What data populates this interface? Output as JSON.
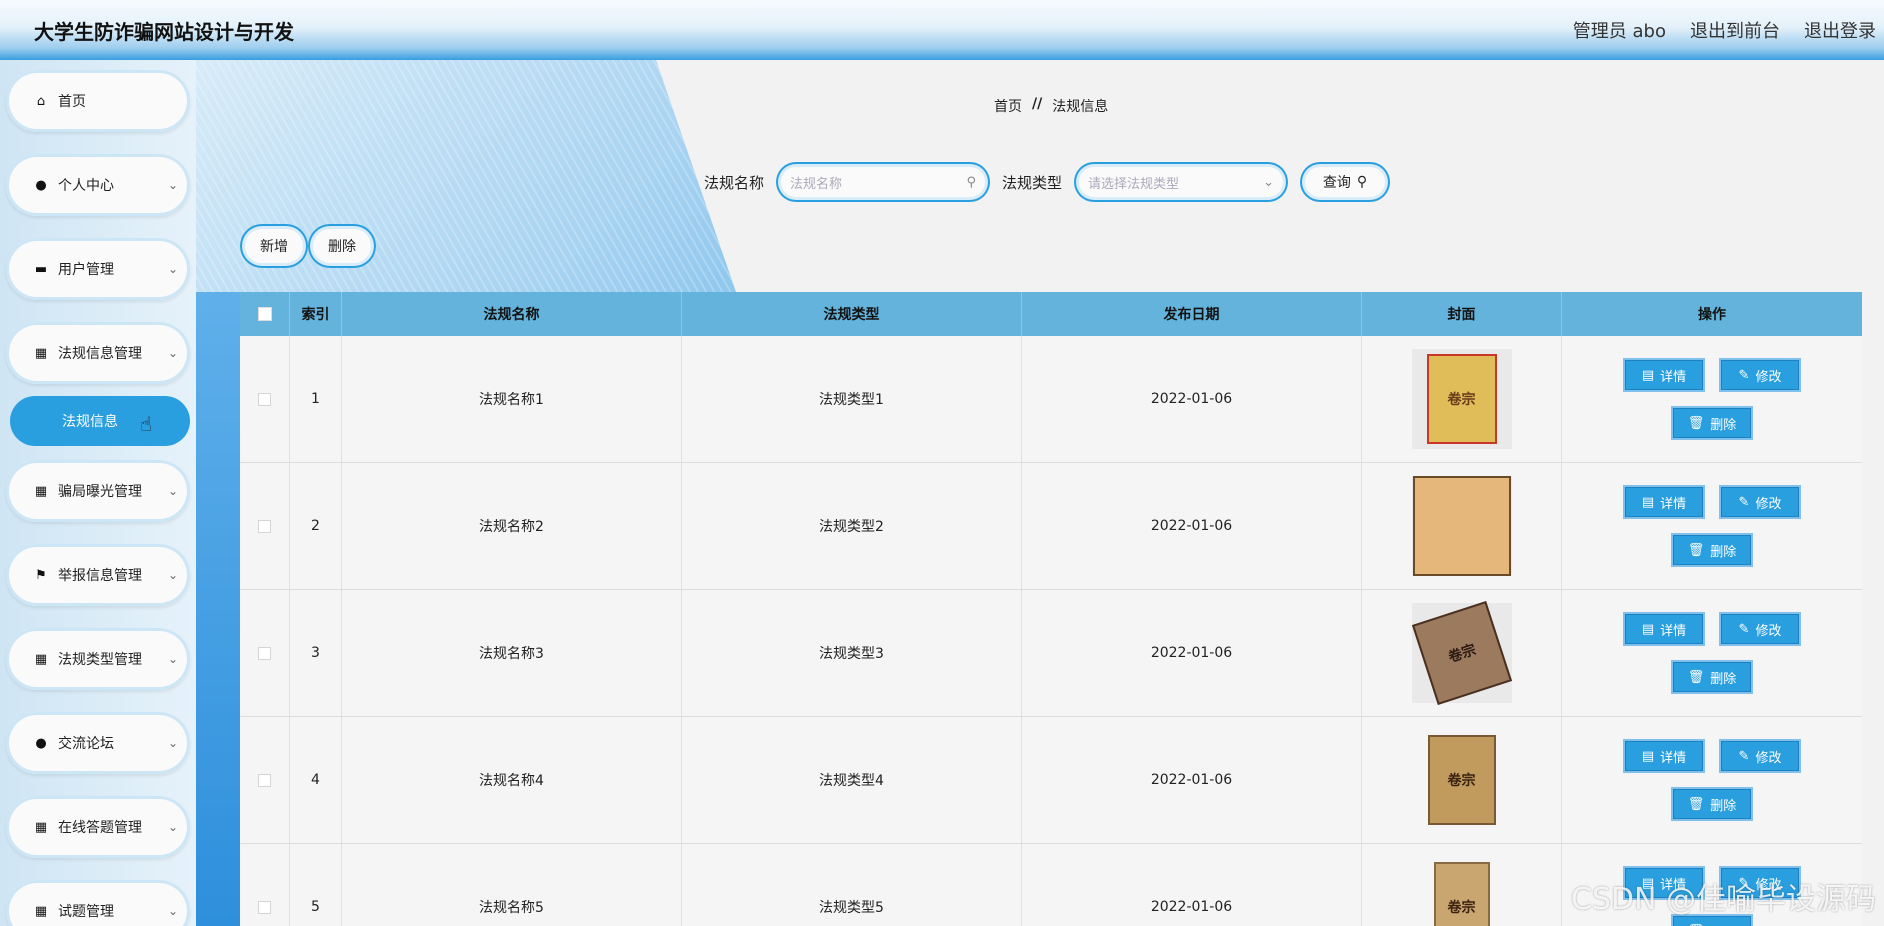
{
  "header": {
    "title": "大学生防诈骗网站设计与开发",
    "admin_label": "管理员 abo",
    "front_link": "退出到前台",
    "logout_link": "退出登录"
  },
  "sidebar": {
    "items": [
      {
        "label": "首页",
        "icon": "home-icon",
        "glyph": "⌂"
      },
      {
        "label": "个人中心",
        "icon": "user-icon",
        "glyph": "●"
      },
      {
        "label": "用户管理",
        "icon": "chat-icon",
        "glyph": "▬"
      },
      {
        "label": "法规信息管理",
        "icon": "grid-icon",
        "glyph": "▦"
      },
      {
        "label": "骗局曝光管理",
        "icon": "grid-icon",
        "glyph": "▦"
      },
      {
        "label": "举报信息管理",
        "icon": "flag-icon",
        "glyph": "⚑"
      },
      {
        "label": "法规类型管理",
        "icon": "grid-icon",
        "glyph": "▦"
      },
      {
        "label": "交流论坛",
        "icon": "bulb-icon",
        "glyph": "●"
      },
      {
        "label": "在线答题管理",
        "icon": "grid-icon",
        "glyph": "▦"
      },
      {
        "label": "试题管理",
        "icon": "grid-icon",
        "glyph": "▦"
      }
    ],
    "active_sub": "法规信息"
  },
  "breadcrumb": {
    "home": "首页",
    "sep": "//",
    "current": "法规信息"
  },
  "search": {
    "name_label": "法规名称",
    "name_placeholder": "法规名称",
    "type_label": "法规类型",
    "type_placeholder": "请选择法规类型",
    "query_label": "查询"
  },
  "actions": {
    "add": "新增",
    "delete": "删除"
  },
  "table": {
    "headers": [
      "索引",
      "法规名称",
      "法规类型",
      "发布日期",
      "封面",
      "操作"
    ],
    "rows": [
      {
        "index": "1",
        "name": "法规名称1",
        "type": "法规类型1",
        "date": "2022-01-06",
        "cover": "卷宗",
        "cover_color": "#e1bd5a"
      },
      {
        "index": "2",
        "name": "法规名称2",
        "type": "法规类型2",
        "date": "2022-01-06",
        "cover": "",
        "cover_color": "#e6b77a"
      },
      {
        "index": "3",
        "name": "法规名称3",
        "type": "法规类型3",
        "date": "2022-01-06",
        "cover": "卷宗",
        "cover_color": "#9b7a5e"
      },
      {
        "index": "4",
        "name": "法规名称4",
        "type": "法规类型4",
        "date": "2022-01-06",
        "cover": "卷宗",
        "cover_color": "#c19a5d"
      },
      {
        "index": "5",
        "name": "法规名称5",
        "type": "法规类型5",
        "date": "2022-01-06",
        "cover": "卷宗",
        "cover_color": "#c9a56f"
      }
    ],
    "op_detail": "详情",
    "op_edit": "修改",
    "op_delete": "删除"
  },
  "watermark": "CSDN @佳喻毕设源码"
}
